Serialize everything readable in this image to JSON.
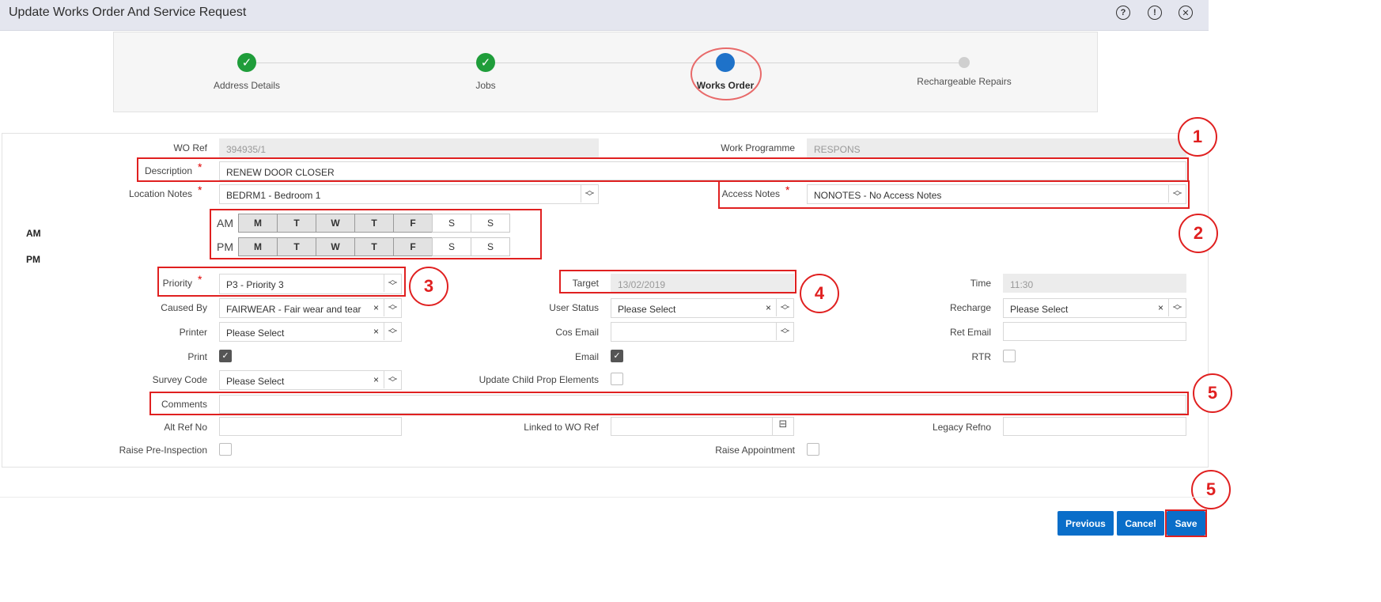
{
  "window": {
    "title": "Update Works Order And Service Request"
  },
  "titlebar_icons": [
    "help-icon",
    "info-icon",
    "close-icon"
  ],
  "wizard": {
    "steps": [
      {
        "label": "Address Details",
        "state": "done"
      },
      {
        "label": "Jobs",
        "state": "done"
      },
      {
        "label": "Works Order",
        "state": "current"
      },
      {
        "label": "Rechargeable Repairs",
        "state": "future"
      }
    ]
  },
  "form": {
    "wo_ref": {
      "label": "WO Ref",
      "value": "394935/1"
    },
    "work_programme": {
      "label": "Work Programme",
      "value": "RESPONS"
    },
    "description": {
      "label": "Description",
      "value": "RENEW DOOR CLOSER"
    },
    "location_notes": {
      "label": "Location Notes",
      "value": "BEDRM1 - Bedroom 1"
    },
    "access_notes": {
      "label": "Access Notes",
      "value": "NONOTES - No Access Notes"
    },
    "required_mark": "*",
    "schedule": {
      "side_am": "AM",
      "side_pm": "PM",
      "am_label": "AM",
      "pm_label": "PM",
      "days": [
        "M",
        "T",
        "W",
        "T",
        "F",
        "S",
        "S"
      ],
      "am_selected": [
        true,
        true,
        true,
        true,
        true,
        false,
        false
      ],
      "pm_selected": [
        true,
        true,
        true,
        true,
        true,
        false,
        false
      ]
    },
    "priority": {
      "label": "Priority",
      "value": "P3 - Priority 3"
    },
    "target": {
      "label": "Target",
      "value": "13/02/2019"
    },
    "time": {
      "label": "Time",
      "value": "11:30"
    },
    "caused_by": {
      "label": "Caused By",
      "value": "FAIRWEAR - Fair wear and tear"
    },
    "user_status": {
      "label": "User Status",
      "value": "Please Select"
    },
    "recharge": {
      "label": "Recharge",
      "value": "Please Select"
    },
    "printer": {
      "label": "Printer",
      "value": "Please Select"
    },
    "cos_email": {
      "label": "Cos Email",
      "value": ""
    },
    "ret_email": {
      "label": "Ret Email",
      "value": ""
    },
    "print": {
      "label": "Print",
      "checked": true
    },
    "email": {
      "label": "Email",
      "checked": true
    },
    "rtr": {
      "label": "RTR",
      "checked": false
    },
    "survey_code": {
      "label": "Survey Code",
      "value": "Please Select"
    },
    "update_child": {
      "label": "Update Child Prop Elements",
      "checked": false
    },
    "comments": {
      "label": "Comments",
      "value": ""
    },
    "alt_ref_no": {
      "label": "Alt Ref No",
      "value": ""
    },
    "linked_wo_ref": {
      "label": "Linked to WO Ref",
      "value": ""
    },
    "legacy_refno": {
      "label": "Legacy Refno",
      "value": ""
    },
    "raise_pre_inspection": {
      "label": "Raise Pre-Inspection",
      "checked": false
    },
    "raise_appointment": {
      "label": "Raise Appointment",
      "checked": false
    }
  },
  "annotations": [
    "1",
    "2",
    "3",
    "4",
    "5",
    "5"
  ],
  "buttons": {
    "previous": "Previous",
    "cancel": "Cancel",
    "save": "Save"
  },
  "glyphs": {
    "check": "✓",
    "clear": "×",
    "spin_up": "︿",
    "spin_down": "﹀",
    "lookup": "⊟"
  },
  "colors": {
    "primary": "#0a6ec9",
    "done": "#1f9d3a",
    "current": "#1e72c9",
    "annotation": "#e02020"
  }
}
